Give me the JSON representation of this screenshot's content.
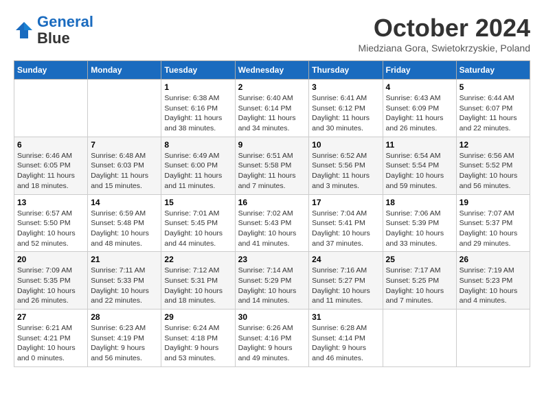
{
  "header": {
    "logo_line1": "General",
    "logo_line2": "Blue",
    "month": "October 2024",
    "location": "Miedziana Gora, Swietokrzyskie, Poland"
  },
  "weekdays": [
    "Sunday",
    "Monday",
    "Tuesday",
    "Wednesday",
    "Thursday",
    "Friday",
    "Saturday"
  ],
  "weeks": [
    [
      {
        "day": "",
        "info": ""
      },
      {
        "day": "",
        "info": ""
      },
      {
        "day": "1",
        "info": "Sunrise: 6:38 AM\nSunset: 6:16 PM\nDaylight: 11 hours and 38 minutes."
      },
      {
        "day": "2",
        "info": "Sunrise: 6:40 AM\nSunset: 6:14 PM\nDaylight: 11 hours and 34 minutes."
      },
      {
        "day": "3",
        "info": "Sunrise: 6:41 AM\nSunset: 6:12 PM\nDaylight: 11 hours and 30 minutes."
      },
      {
        "day": "4",
        "info": "Sunrise: 6:43 AM\nSunset: 6:09 PM\nDaylight: 11 hours and 26 minutes."
      },
      {
        "day": "5",
        "info": "Sunrise: 6:44 AM\nSunset: 6:07 PM\nDaylight: 11 hours and 22 minutes."
      }
    ],
    [
      {
        "day": "6",
        "info": "Sunrise: 6:46 AM\nSunset: 6:05 PM\nDaylight: 11 hours and 18 minutes."
      },
      {
        "day": "7",
        "info": "Sunrise: 6:48 AM\nSunset: 6:03 PM\nDaylight: 11 hours and 15 minutes."
      },
      {
        "day": "8",
        "info": "Sunrise: 6:49 AM\nSunset: 6:00 PM\nDaylight: 11 hours and 11 minutes."
      },
      {
        "day": "9",
        "info": "Sunrise: 6:51 AM\nSunset: 5:58 PM\nDaylight: 11 hours and 7 minutes."
      },
      {
        "day": "10",
        "info": "Sunrise: 6:52 AM\nSunset: 5:56 PM\nDaylight: 11 hours and 3 minutes."
      },
      {
        "day": "11",
        "info": "Sunrise: 6:54 AM\nSunset: 5:54 PM\nDaylight: 10 hours and 59 minutes."
      },
      {
        "day": "12",
        "info": "Sunrise: 6:56 AM\nSunset: 5:52 PM\nDaylight: 10 hours and 56 minutes."
      }
    ],
    [
      {
        "day": "13",
        "info": "Sunrise: 6:57 AM\nSunset: 5:50 PM\nDaylight: 10 hours and 52 minutes."
      },
      {
        "day": "14",
        "info": "Sunrise: 6:59 AM\nSunset: 5:48 PM\nDaylight: 10 hours and 48 minutes."
      },
      {
        "day": "15",
        "info": "Sunrise: 7:01 AM\nSunset: 5:45 PM\nDaylight: 10 hours and 44 minutes."
      },
      {
        "day": "16",
        "info": "Sunrise: 7:02 AM\nSunset: 5:43 PM\nDaylight: 10 hours and 41 minutes."
      },
      {
        "day": "17",
        "info": "Sunrise: 7:04 AM\nSunset: 5:41 PM\nDaylight: 10 hours and 37 minutes."
      },
      {
        "day": "18",
        "info": "Sunrise: 7:06 AM\nSunset: 5:39 PM\nDaylight: 10 hours and 33 minutes."
      },
      {
        "day": "19",
        "info": "Sunrise: 7:07 AM\nSunset: 5:37 PM\nDaylight: 10 hours and 29 minutes."
      }
    ],
    [
      {
        "day": "20",
        "info": "Sunrise: 7:09 AM\nSunset: 5:35 PM\nDaylight: 10 hours and 26 minutes."
      },
      {
        "day": "21",
        "info": "Sunrise: 7:11 AM\nSunset: 5:33 PM\nDaylight: 10 hours and 22 minutes."
      },
      {
        "day": "22",
        "info": "Sunrise: 7:12 AM\nSunset: 5:31 PM\nDaylight: 10 hours and 18 minutes."
      },
      {
        "day": "23",
        "info": "Sunrise: 7:14 AM\nSunset: 5:29 PM\nDaylight: 10 hours and 14 minutes."
      },
      {
        "day": "24",
        "info": "Sunrise: 7:16 AM\nSunset: 5:27 PM\nDaylight: 10 hours and 11 minutes."
      },
      {
        "day": "25",
        "info": "Sunrise: 7:17 AM\nSunset: 5:25 PM\nDaylight: 10 hours and 7 minutes."
      },
      {
        "day": "26",
        "info": "Sunrise: 7:19 AM\nSunset: 5:23 PM\nDaylight: 10 hours and 4 minutes."
      }
    ],
    [
      {
        "day": "27",
        "info": "Sunrise: 6:21 AM\nSunset: 4:21 PM\nDaylight: 10 hours and 0 minutes."
      },
      {
        "day": "28",
        "info": "Sunrise: 6:23 AM\nSunset: 4:19 PM\nDaylight: 9 hours and 56 minutes."
      },
      {
        "day": "29",
        "info": "Sunrise: 6:24 AM\nSunset: 4:18 PM\nDaylight: 9 hours and 53 minutes."
      },
      {
        "day": "30",
        "info": "Sunrise: 6:26 AM\nSunset: 4:16 PM\nDaylight: 9 hours and 49 minutes."
      },
      {
        "day": "31",
        "info": "Sunrise: 6:28 AM\nSunset: 4:14 PM\nDaylight: 9 hours and 46 minutes."
      },
      {
        "day": "",
        "info": ""
      },
      {
        "day": "",
        "info": ""
      }
    ]
  ]
}
